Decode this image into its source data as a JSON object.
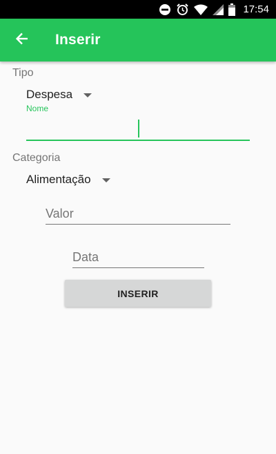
{
  "status_bar": {
    "time": "17:54",
    "icons": [
      "do-not-disturb-icon",
      "alarm-icon",
      "wifi-icon",
      "signal-icon",
      "battery-icon"
    ]
  },
  "app_bar": {
    "title": "Inserir",
    "back_icon": "arrow-back-icon",
    "color": "#25c45a"
  },
  "form": {
    "tipo": {
      "label": "Tipo",
      "selected": "Despesa"
    },
    "nome": {
      "label": "Nome",
      "value": ""
    },
    "categoria": {
      "label": "Categoria",
      "selected": "Alimentação"
    },
    "valor": {
      "placeholder": "Valor",
      "value": ""
    },
    "data": {
      "placeholder": "Data",
      "value": ""
    },
    "submit_label": "INSERIR"
  },
  "colors": {
    "accent": "#25c45a",
    "background": "#fafafa",
    "button": "#d6d7d7"
  }
}
